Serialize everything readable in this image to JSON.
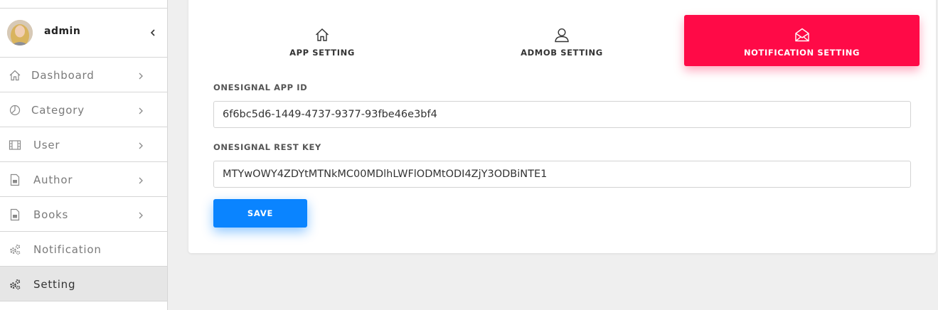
{
  "user": {
    "name": "admin"
  },
  "sidebar": {
    "items": [
      {
        "label": "Dashboard",
        "icon": "home-icon"
      },
      {
        "label": "Category",
        "icon": "pie-chart-icon"
      },
      {
        "label": "User",
        "icon": "film-icon"
      },
      {
        "label": "Author",
        "icon": "file-icon"
      },
      {
        "label": "Books",
        "icon": "file-icon"
      },
      {
        "label": "Notification",
        "icon": "gears-icon"
      },
      {
        "label": "Setting",
        "icon": "gears-icon"
      }
    ],
    "active": "Setting"
  },
  "tabs": {
    "app": {
      "label": "APP SETTING",
      "icon": "home-icon"
    },
    "admob": {
      "label": "ADMOB SETTING",
      "icon": "user-icon"
    },
    "notification": {
      "label": "NOTIFICATION SETTING",
      "icon": "envelope-open-icon"
    }
  },
  "form": {
    "app_id": {
      "label": "ONESIGNAL APP ID",
      "value": "6f6bc5d6-1449-4737-9377-93fbe46e3bf4"
    },
    "rest_key": {
      "label": "ONESIGNAL REST KEY",
      "value": "MTYwOWY4ZDYtMTNkMC00MDlhLWFlODMtODI4ZjY3ODBiNTE1"
    },
    "save_label": "SAVE"
  },
  "colors": {
    "active_tab": "#ff0a47",
    "save_button": "#0a84ff",
    "active_nav": "#e6e6e6"
  }
}
